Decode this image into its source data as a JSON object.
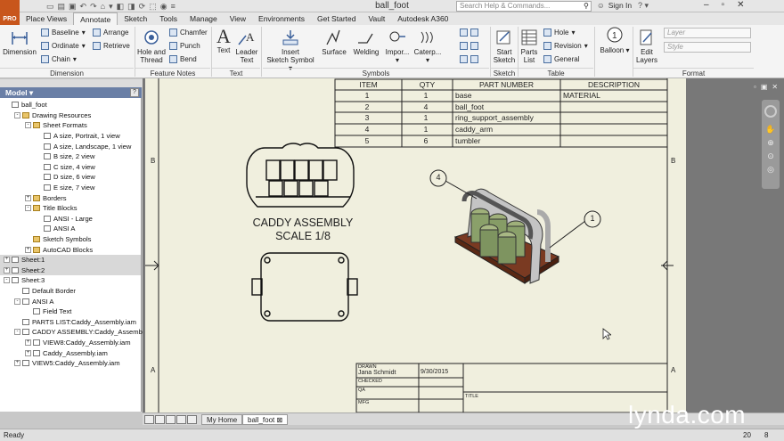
{
  "title_bar": {
    "app_badge": "PRO",
    "title": "ball_foot",
    "search_placeholder": "Search Help & Commands...",
    "sign_in": "Sign In"
  },
  "menu_tabs": [
    "Place Views",
    "Annotate",
    "Sketch",
    "Tools",
    "Manage",
    "View",
    "Environments",
    "Get Started",
    "Vault",
    "Autodesk A360"
  ],
  "active_tab": "Annotate",
  "ribbon": {
    "dimension": {
      "big": "Dimension",
      "baseline": "Baseline",
      "ordinate": "Ordinate",
      "chain": "Chain",
      "arrange": "Arrange",
      "retrieve": "Retrieve",
      "group": "Dimension"
    },
    "feature_notes": {
      "hole_thread_1": "Hole and",
      "hole_thread_2": "Thread",
      "chamfer": "Chamfer",
      "punch": "Punch",
      "bend": "Bend",
      "group": "Feature Notes"
    },
    "text": {
      "text": "Text",
      "leader_1": "Leader",
      "leader_2": "Text",
      "group": "Text"
    },
    "symbols": {
      "insert_1": "Insert",
      "insert_2": "Sketch Symbol",
      "surface": "Surface",
      "welding": "Welding",
      "import": "Impor...",
      "caterpillar": "Caterp...",
      "group": "Symbols"
    },
    "sketch": {
      "start_1": "Start",
      "start_2": "Sketch",
      "group": "Sketch"
    },
    "table": {
      "parts_1": "Parts",
      "parts_2": "List",
      "hole": "Hole",
      "revision": "Revision",
      "general": "General",
      "group": "Table"
    },
    "balloon": {
      "label": "Balloon"
    },
    "format": {
      "edit_1": "Edit",
      "edit_2": "Layers",
      "layer": "Layer",
      "style": "Style",
      "group": "Format"
    }
  },
  "browser": {
    "header": "Model",
    "items": [
      {
        "label": "ball_foot",
        "indent": 0,
        "icon": "doc"
      },
      {
        "label": "Drawing Resources",
        "indent": 1,
        "icon": "fold",
        "exp": "-"
      },
      {
        "label": "Sheet Formats",
        "indent": 2,
        "icon": "fold",
        "exp": "-"
      },
      {
        "label": "A size, Portrait, 1 view",
        "indent": 3,
        "icon": "doc"
      },
      {
        "label": "A size, Landscape, 1 view",
        "indent": 3,
        "icon": "doc"
      },
      {
        "label": "B size, 2 view",
        "indent": 3,
        "icon": "doc"
      },
      {
        "label": "C size, 4 view",
        "indent": 3,
        "icon": "doc"
      },
      {
        "label": "D size, 6 view",
        "indent": 3,
        "icon": "doc"
      },
      {
        "label": "E size, 7 view",
        "indent": 3,
        "icon": "doc"
      },
      {
        "label": "Borders",
        "indent": 2,
        "icon": "fold",
        "exp": "+"
      },
      {
        "label": "Title Blocks",
        "indent": 2,
        "icon": "fold",
        "exp": "-"
      },
      {
        "label": "ANSI - Large",
        "indent": 3,
        "icon": "doc"
      },
      {
        "label": "ANSI A",
        "indent": 3,
        "icon": "doc"
      },
      {
        "label": "Sketch Symbols",
        "indent": 2,
        "icon": "fold"
      },
      {
        "label": "AutoCAD Blocks",
        "indent": 2,
        "icon": "fold",
        "exp": "+"
      },
      {
        "label": "Sheet:1",
        "indent": 0,
        "icon": "doc",
        "exp": "+",
        "hl": true
      },
      {
        "label": "Sheet:2",
        "indent": 0,
        "icon": "doc",
        "exp": "+",
        "hl": true
      },
      {
        "label": "Sheet:3",
        "indent": 0,
        "icon": "doc",
        "exp": "-"
      },
      {
        "label": "Default Border",
        "indent": 1,
        "icon": "doc"
      },
      {
        "label": "ANSI A",
        "indent": 1,
        "icon": "doc",
        "exp": "-"
      },
      {
        "label": "Field Text",
        "indent": 2,
        "icon": "doc"
      },
      {
        "label": "PARTS LIST:Caddy_Assembly.iam",
        "indent": 1,
        "icon": "doc"
      },
      {
        "label": "CADDY ASSEMBLY:Caddy_Assembly...",
        "indent": 1,
        "icon": "doc",
        "exp": "-"
      },
      {
        "label": "VIEW8:Caddy_Assembly.iam",
        "indent": 2,
        "icon": "doc",
        "exp": "+"
      },
      {
        "label": "Caddy_Assembly.iam",
        "indent": 2,
        "icon": "doc",
        "exp": "+"
      },
      {
        "label": "VIEW5:Caddy_Assembly.iam",
        "indent": 1,
        "icon": "doc",
        "exp": "+"
      }
    ]
  },
  "parts_list": {
    "headers": [
      "ITEM",
      "QTY",
      "PART NUMBER",
      "DESCRIPTION"
    ],
    "rows": [
      [
        "1",
        "1",
        "base",
        "MATERIAL"
      ],
      [
        "2",
        "4",
        "ball_foot",
        ""
      ],
      [
        "3",
        "1",
        "ring_support_assembly",
        ""
      ],
      [
        "4",
        "1",
        "caddy_arm",
        ""
      ],
      [
        "5",
        "6",
        "tumbler",
        ""
      ]
    ]
  },
  "drawing": {
    "view_title_1": "CADDY ASSEMBLY",
    "view_title_2": "SCALE 1/8",
    "balloon_a": "4",
    "balloon_b": "1",
    "zone_b": "B",
    "zone_a": "A",
    "title_block": {
      "drawn": "DRAWN",
      "drawn_by": "Jana Schmidt",
      "drawn_date": "9/30/2015",
      "checked": "CHECKED",
      "qa": "QA",
      "mfg": "MFG",
      "title": "TITLE"
    }
  },
  "doc_tabs": {
    "home": "My Home",
    "file": "ball_foot"
  },
  "status": {
    "text": "Ready",
    "n1": "20",
    "n2": "8"
  },
  "watermark": "lynda.com"
}
